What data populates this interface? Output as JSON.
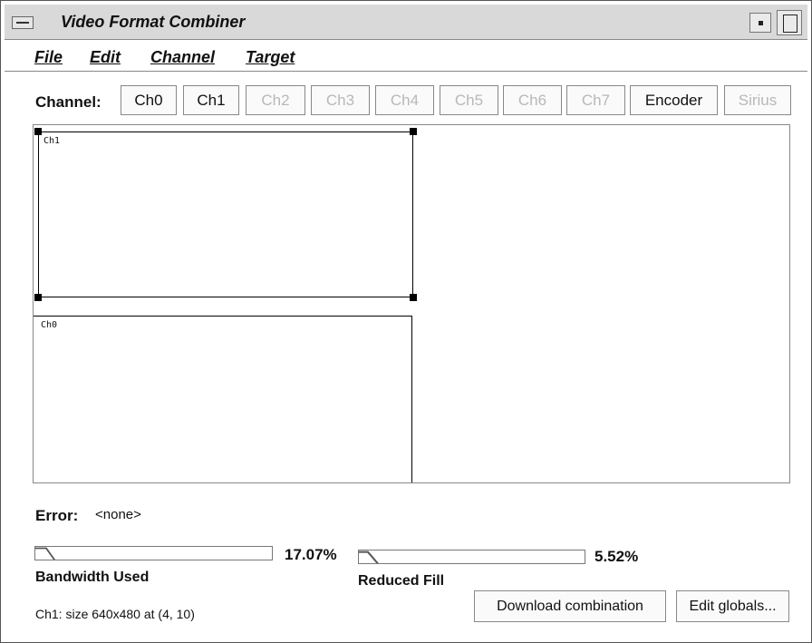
{
  "window": {
    "title": "Video Format Combiner"
  },
  "menubar": {
    "items": [
      {
        "label": "File"
      },
      {
        "label": "Edit"
      },
      {
        "label": "Channel"
      },
      {
        "label": "Target"
      }
    ]
  },
  "channel_bar": {
    "label": "Channel:",
    "buttons": [
      {
        "label": "Ch0",
        "enabled": true
      },
      {
        "label": "Ch1",
        "enabled": true
      },
      {
        "label": "Ch2",
        "enabled": false
      },
      {
        "label": "Ch3",
        "enabled": false
      },
      {
        "label": "Ch4",
        "enabled": false
      },
      {
        "label": "Ch5",
        "enabled": false
      },
      {
        "label": "Ch6",
        "enabled": false
      },
      {
        "label": "Ch7",
        "enabled": false
      },
      {
        "label": "Encoder",
        "enabled": true
      },
      {
        "label": "Sirius",
        "enabled": false
      }
    ]
  },
  "canvas": {
    "ch1_label": "Ch1",
    "ch0_label": "Ch0"
  },
  "error": {
    "label": "Error:",
    "value": "<none>"
  },
  "bandwidth": {
    "percent_text": "17.07%",
    "fraction": 0.1707,
    "label": "Bandwidth Used"
  },
  "reduced_fill": {
    "percent_text": "5.52%",
    "fraction": 0.0552,
    "label": "Reduced Fill"
  },
  "status": {
    "text": "Ch1: size 640x480 at (4, 10)"
  },
  "actions": {
    "download_label": "Download combination",
    "edit_globals_label": "Edit globals..."
  }
}
